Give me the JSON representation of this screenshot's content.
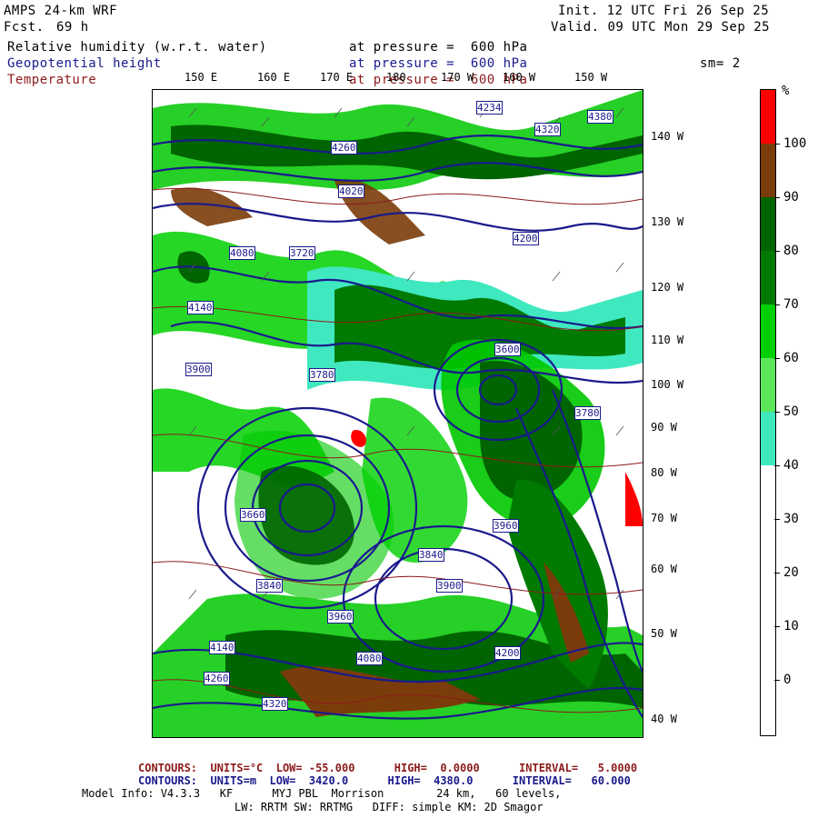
{
  "header": {
    "model": "AMPS 24-km WRF",
    "fcst_label": "Fcst.",
    "fcst_value": "69 h",
    "init": "Init. 12 UTC Fri 26 Sep 25",
    "valid": "Valid. 09 UTC Mon 29 Sep 25",
    "sm": "sm= 2"
  },
  "fields": [
    {
      "name": "Relative humidity (w.r.t. water)",
      "level": "at pressure =  600 hPa",
      "color": "#000000"
    },
    {
      "name": "Geopotential height",
      "level": "at pressure =  600 hPa",
      "color": "#1a1a8c"
    },
    {
      "name": "Temperature",
      "level": "at pressure =  600 hPa",
      "color": "#8c1a1a"
    }
  ],
  "map": {
    "top_lon_labels": [
      "150 E",
      "160 E",
      "170 E",
      "180",
      "170 W",
      "160 W",
      "150 W"
    ],
    "right_lon_labels": [
      "140 W",
      "130 W",
      "120 W",
      "110 W",
      "100 W",
      "90 W",
      "80 W",
      "70 W",
      "60 W",
      "50 W",
      "40 W"
    ],
    "height_labels": [
      "4234",
      "4380",
      "4320",
      "4260",
      "4200",
      "4140",
      "4080",
      "4020",
      "3960",
      "3900",
      "3840",
      "3780",
      "3720",
      "3660",
      "3600",
      "4320",
      "4260",
      "4200",
      "4140",
      "4080",
      "3960",
      "3900",
      "3840",
      "3780"
    ]
  },
  "colorbar": {
    "unit": "%",
    "labels": [
      "100",
      "90",
      "80",
      "70",
      "60",
      "50",
      "40",
      "30",
      "20",
      "10",
      "0"
    ],
    "colors": [
      "#ff0000",
      "#7a3c0a",
      "#006400",
      "#007a00",
      "#00d000",
      "#5ae85a",
      "#40e8c0",
      "#ffffff",
      "#ffffff",
      "#ffffff",
      "#ffffff",
      "#ffffff"
    ]
  },
  "footer": {
    "temp_contours": "CONTOURS:  UNITS=°C  LOW= -55.000      HIGH=  0.0000      INTERVAL=   5.0000",
    "height_contours": "CONTOURS:  UNITS=m  LOW=  3420.0      HIGH=  4380.0      INTERVAL=   60.000",
    "model_info": "Model Info: V4.3.3   KF      MYJ PBL  Morrison        24 km,   60 levels,",
    "model_info2": "LW: RRTM SW: RRTMG   DIFF: simple KM: 2D Smagor"
  }
}
